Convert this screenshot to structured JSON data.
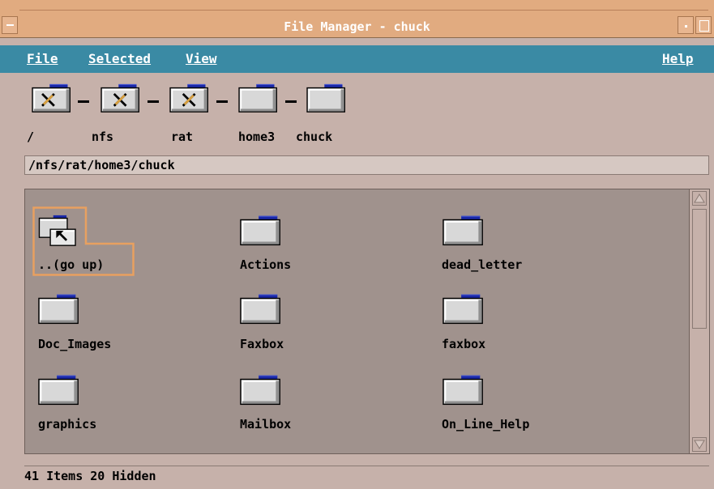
{
  "window": {
    "title": "File Manager - chuck"
  },
  "menubar": {
    "file": "File",
    "selected": "Selected",
    "view": "View",
    "help": "Help"
  },
  "path_icons": [
    {
      "label": "/",
      "icon": "folder-restricted-icon"
    },
    {
      "label": "nfs",
      "icon": "folder-restricted-icon"
    },
    {
      "label": "rat",
      "icon": "folder-restricted-icon"
    },
    {
      "label": "home3",
      "icon": "folder-icon"
    },
    {
      "label": "chuck",
      "icon": "folder-icon"
    }
  ],
  "path_field": {
    "value": "/nfs/rat/home3/chuck"
  },
  "items": [
    {
      "label": "..(go up)",
      "icon": "folder-up-icon",
      "selected": true
    },
    {
      "label": "Actions",
      "icon": "folder-icon"
    },
    {
      "label": "dead_letter",
      "icon": "folder-icon"
    },
    {
      "label": "Doc_Images",
      "icon": "folder-icon"
    },
    {
      "label": "Faxbox",
      "icon": "folder-icon"
    },
    {
      "label": "faxbox",
      "icon": "folder-icon"
    },
    {
      "label": "graphics",
      "icon": "folder-icon"
    },
    {
      "label": "Mailbox",
      "icon": "folder-icon"
    },
    {
      "label": "On_Line_Help",
      "icon": "folder-icon"
    }
  ],
  "status": {
    "text": "41 Items 20 Hidden"
  },
  "colors": {
    "titlebar": "#e1ab80",
    "menubar": "#3a8aa4",
    "window_bg": "#c6b1aa",
    "content_bg": "#a0928d",
    "selection": "#e8a060",
    "folder_tab": "#1a28a8"
  }
}
